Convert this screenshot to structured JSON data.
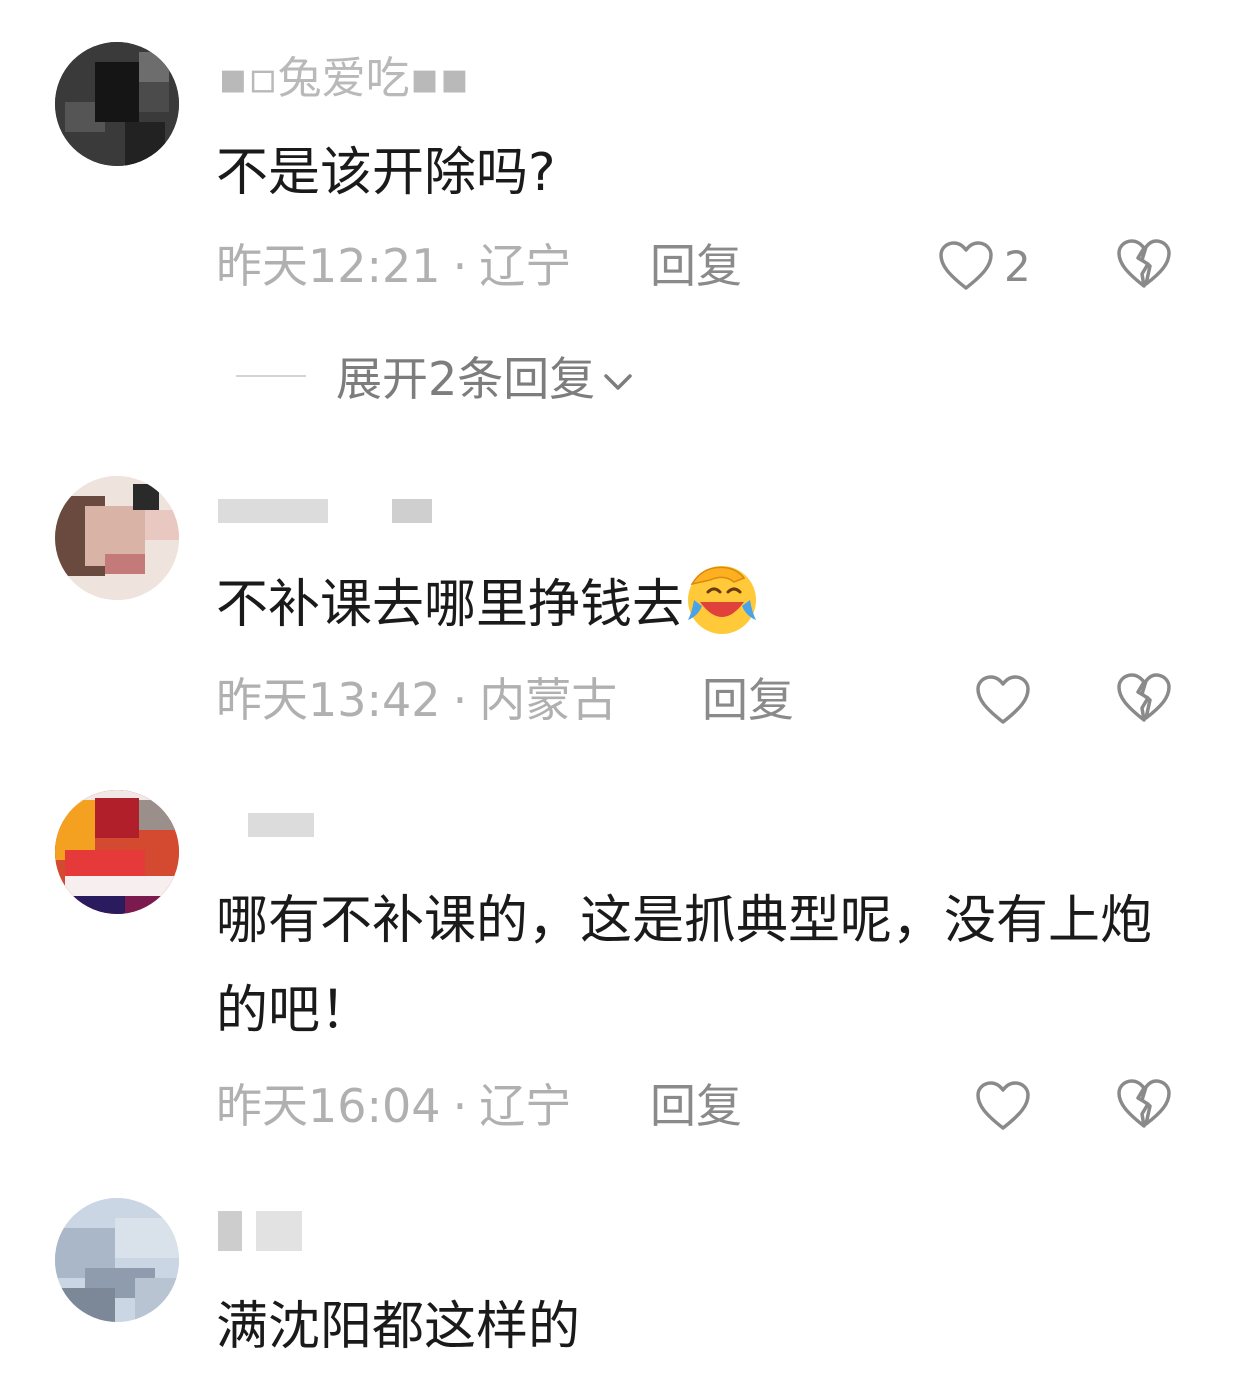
{
  "comments": [
    {
      "username": "▪▫兔爱吃▪▪",
      "text": "不是该开除吗?",
      "time": "昨天12:21",
      "location": "辽宁",
      "reply_label": "回复",
      "like_count": "2"
    },
    {
      "username": "",
      "text": "不补课去哪里挣钱去",
      "emoji": "facepalm-laughing-emoji",
      "time": "昨天13:42",
      "location": "内蒙古",
      "reply_label": "回复"
    },
    {
      "username": "",
      "text": "哪有不补课的，这是抓典型呢，没有上炮的吧！",
      "time": "昨天16:04",
      "location": "辽宁",
      "reply_label": "回复"
    },
    {
      "username": "",
      "text": "满沈阳都这样的"
    }
  ],
  "expand_replies_label": "展开2条回复",
  "separator": "·",
  "colors": {
    "text": "#1a1a1a",
    "meta": "#b0b0b0",
    "action": "#8a8a8a"
  }
}
